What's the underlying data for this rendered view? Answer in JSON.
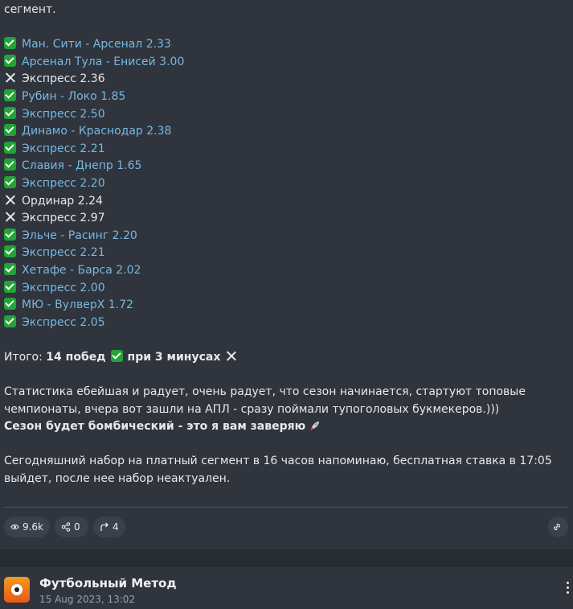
{
  "post": {
    "intro_tail": "сегмент.",
    "results": [
      {
        "status": "win",
        "text": "Ман. Сити - Арсенал 2.33"
      },
      {
        "status": "win",
        "text": "Арсенал Тула - Енисей 3.00"
      },
      {
        "status": "loss",
        "text": "Экспресс 2.36"
      },
      {
        "status": "win",
        "text": "Рубин - Локо 1.85"
      },
      {
        "status": "win",
        "text": "Экспресс 2.50"
      },
      {
        "status": "win",
        "text": "Динамо - Краснодар 2.38"
      },
      {
        "status": "win",
        "text": "Экспресс 2.21"
      },
      {
        "status": "win",
        "text": "Славия - Днепр 1.65"
      },
      {
        "status": "win",
        "text": "Экспресс 2.20"
      },
      {
        "status": "loss",
        "text": "Ординар 2.24"
      },
      {
        "status": "loss",
        "text": "Экспресс 2.97"
      },
      {
        "status": "win",
        "text": "Эльче - Расинг 2.20"
      },
      {
        "status": "win",
        "text": "Экспресс 2.21"
      },
      {
        "status": "win",
        "text": "Хетафе - Барса 2.02"
      },
      {
        "status": "win",
        "text": "Экспресс 2.00"
      },
      {
        "status": "win",
        "text": "МЮ - ВулверХ 1.72"
      },
      {
        "status": "win",
        "text": "Экспресс 2.05"
      }
    ],
    "summary_prefix": "Итого:",
    "summary_wins": "14 побед",
    "summary_losses": "при 3 минусах",
    "stats_text": "Статистика ебейшая и радует, очень радует, что сезон начинается, стартуют топовые чемпионаты, вчера вот зашли на АПЛ - сразу поймали тупоголовых букмекеров.)))",
    "season_text": "Сезон будет бомбический - это я вам заверяю",
    "announcement_text": "Сегодняшний набор на платный сегмент в 16 часов напоминаю, бесплатная ставка в 17:05 выйдет, после нее набор неактуален."
  },
  "actions": {
    "views": "9.6k",
    "reactions": "0",
    "shares": "4"
  },
  "next_post": {
    "channel_name": "Футбольный Метод",
    "date": "15 Aug 2023, 13:02"
  },
  "colors": {
    "background": "#2f343d",
    "link": "#79b8e0",
    "check": "#22a436"
  }
}
